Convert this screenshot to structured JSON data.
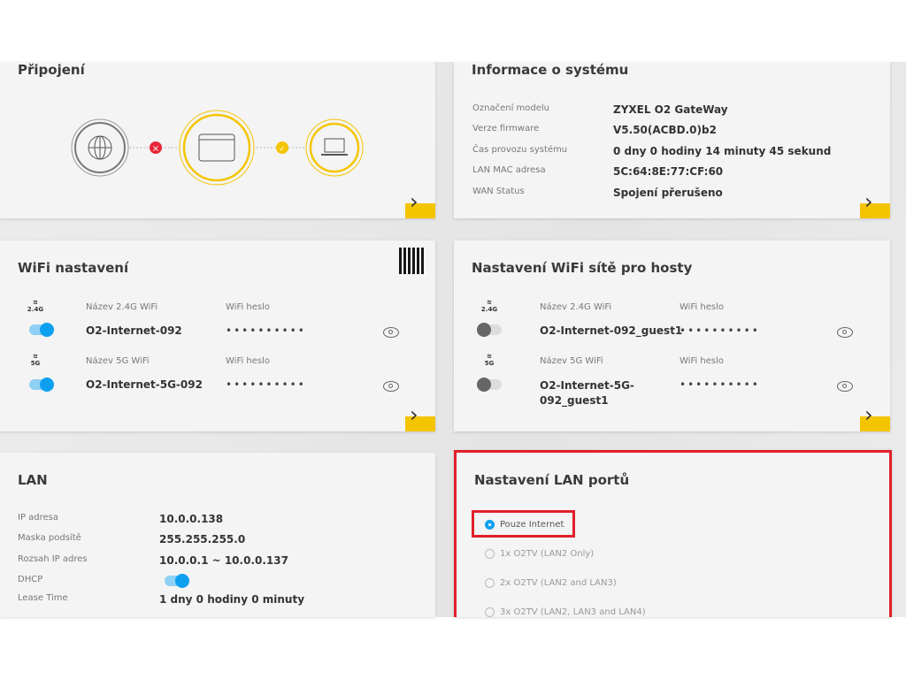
{
  "connection": {
    "title": "Připojení",
    "internet_status": "disconnected",
    "client_status": "connected"
  },
  "system": {
    "title": "Informace o systému",
    "rows": [
      {
        "label": "Označení modelu",
        "value": "ZYXEL O2 GateWay"
      },
      {
        "label": "Verze firmware",
        "value": "V5.50(ACBD.0)b2"
      },
      {
        "label": "Čas provozu systému",
        "value": "0 dny 0 hodiny 14 minuty 45 sekund"
      },
      {
        "label": "LAN MAC adresa",
        "value": "5C:64:8E:77:CF:60"
      },
      {
        "label": "WAN Status",
        "value": "Spojení přerušeno"
      }
    ]
  },
  "wifi": {
    "title": "WiFi nastavení",
    "rows": [
      {
        "band": "2.4G",
        "name_label": "Název 2.4G WiFi",
        "name": "O2-Internet-092",
        "pass_label": "WiFi heslo",
        "pass": "••••••••••",
        "enabled": true
      },
      {
        "band": "5G",
        "name_label": "Název 5G WiFi",
        "name": "O2-Internet-5G-092",
        "pass_label": "WiFi heslo",
        "pass": "••••••••••",
        "enabled": true
      }
    ]
  },
  "guest": {
    "title": "Nastavení WiFi sítě pro hosty",
    "rows": [
      {
        "band": "2.4G",
        "name_label": "Název 2.4G WiFi",
        "name": "O2-Internet-092_guest1",
        "pass_label": "WiFi heslo",
        "pass": "••••••••••",
        "enabled": false
      },
      {
        "band": "5G",
        "name_label": "Název 5G WiFi",
        "name": "O2-Internet-5G-092_guest1",
        "pass_label": "WiFi heslo",
        "pass": "••••••••••",
        "enabled": false
      }
    ]
  },
  "lan": {
    "title": "LAN",
    "rows": [
      {
        "label": "IP adresa",
        "value": "10.0.0.138"
      },
      {
        "label": "Maska podsítě",
        "value": "255.255.255.0"
      },
      {
        "label": "Rozsah IP adres",
        "value": "10.0.0.1 ~ 10.0.0.137"
      },
      {
        "label": "DHCP",
        "value": null
      },
      {
        "label": "Lease Time",
        "value": "1 dny 0 hodiny 0 minuty"
      }
    ]
  },
  "lan_ports": {
    "title": "Nastavení LAN portů",
    "options": [
      "Pouze Internet",
      "1x O2TV (LAN2 Only)",
      "2x O2TV (LAN2 and LAN3)",
      "3x O2TV (LAN2, LAN3 and LAN4)"
    ],
    "selected": 0
  },
  "colors": {
    "accent": "#f5c400",
    "toggle": "#0ea0f0",
    "highlight": "#e0202a"
  }
}
